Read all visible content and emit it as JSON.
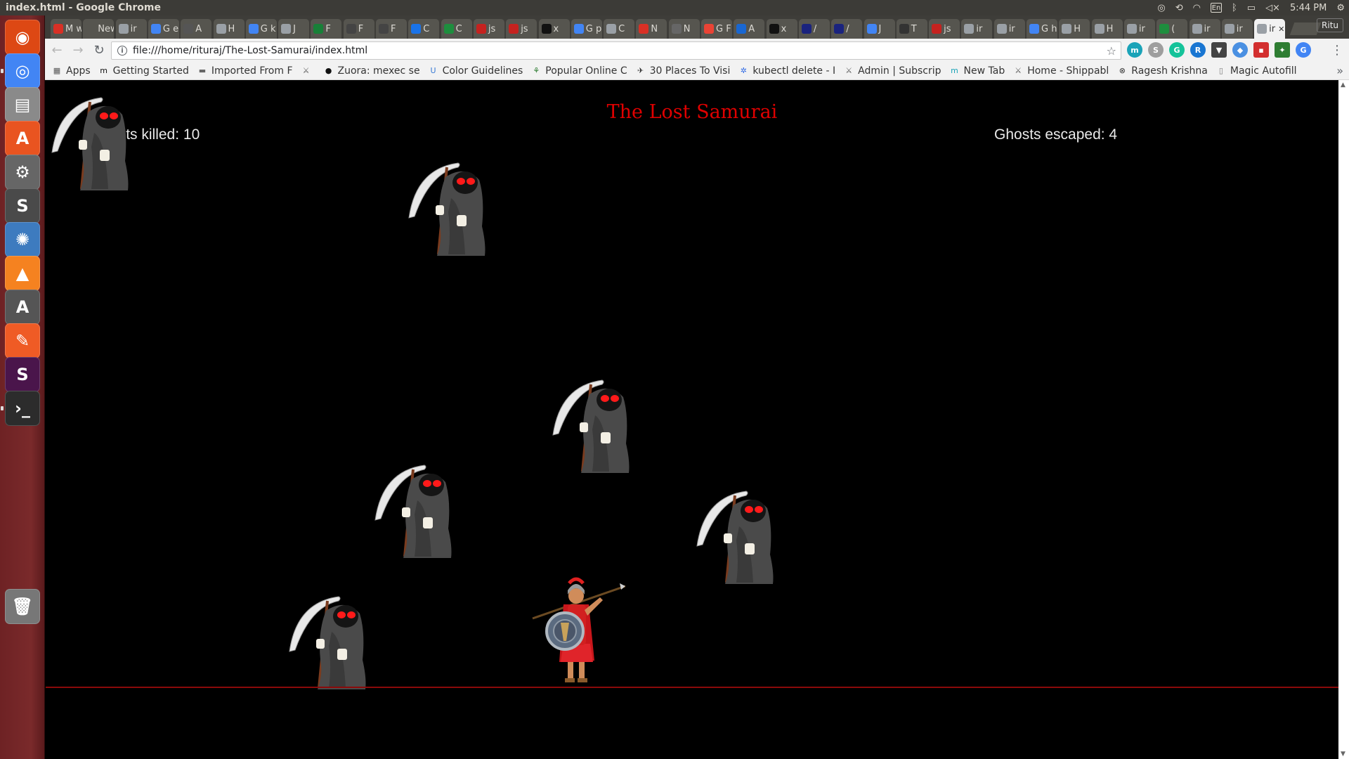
{
  "os": {
    "window_title": "index.html - Google Chrome",
    "keyboard_layout": "En",
    "time": "5:44 PM"
  },
  "launcher": {
    "items": [
      {
        "name": "ubuntu-dash",
        "glyph": "◉",
        "color": "#dd4814"
      },
      {
        "name": "chrome",
        "glyph": "◎",
        "color": "#4285f4"
      },
      {
        "name": "files",
        "glyph": "▤",
        "color": "#8a8a8a"
      },
      {
        "name": "software-center",
        "glyph": "A",
        "color": "#e95420"
      },
      {
        "name": "system-settings",
        "glyph": "⚙",
        "color": "#666"
      },
      {
        "name": "sublime-text",
        "glyph": "S",
        "color": "#4a4a4a"
      },
      {
        "name": "shotwell",
        "glyph": "✺",
        "color": "#3d7bbf"
      },
      {
        "name": "vlc",
        "glyph": "▲",
        "color": "#f58220"
      },
      {
        "name": "software-updater",
        "glyph": "A",
        "color": "#555"
      },
      {
        "name": "postman",
        "glyph": "✎",
        "color": "#ef5b25"
      },
      {
        "name": "slack",
        "glyph": "S",
        "color": "#4a154b"
      },
      {
        "name": "terminal",
        "glyph": "›_",
        "color": "#2c2c2c"
      },
      {
        "name": "trash",
        "glyph": "🗑",
        "color": "#777"
      }
    ]
  },
  "tabs": [
    {
      "label": "M w",
      "color": "#d93025"
    },
    {
      "label": "New",
      "color": "#56554f"
    },
    {
      "label": "ir",
      "color": "#9aa0a6"
    },
    {
      "label": "G e",
      "color": "#4285f4"
    },
    {
      "label": "A",
      "color": "#555"
    },
    {
      "label": "H",
      "color": "#9aa0a6"
    },
    {
      "label": "G k",
      "color": "#4285f4"
    },
    {
      "label": "J",
      "color": "#9aa0a6"
    },
    {
      "label": "F",
      "color": "#188038"
    },
    {
      "label": "F",
      "color": "#444"
    },
    {
      "label": "F",
      "color": "#444"
    },
    {
      "label": "C",
      "color": "#1a73e8"
    },
    {
      "label": "C",
      "color": "#1e8e3e"
    },
    {
      "label": "js",
      "color": "#c5221f"
    },
    {
      "label": "js",
      "color": "#c5221f"
    },
    {
      "label": "x",
      "color": "#111"
    },
    {
      "label": "G p",
      "color": "#4285f4"
    },
    {
      "label": "C",
      "color": "#9aa0a6"
    },
    {
      "label": "N",
      "color": "#d93025"
    },
    {
      "label": "N",
      "color": "#666"
    },
    {
      "label": "G F",
      "color": "#ea4335"
    },
    {
      "label": "A",
      "color": "#1967d2"
    },
    {
      "label": "x",
      "color": "#111"
    },
    {
      "label": "/",
      "color": "#1a237e"
    },
    {
      "label": "/",
      "color": "#1a237e"
    },
    {
      "label": "J",
      "color": "#4285f4"
    },
    {
      "label": "T",
      "color": "#333"
    },
    {
      "label": "js",
      "color": "#c5221f"
    },
    {
      "label": "ir",
      "color": "#9aa0a6"
    },
    {
      "label": "ir",
      "color": "#9aa0a6"
    },
    {
      "label": "G h",
      "color": "#4285f4"
    },
    {
      "label": "H",
      "color": "#9aa0a6"
    },
    {
      "label": "H",
      "color": "#9aa0a6"
    },
    {
      "label": "ir",
      "color": "#9aa0a6"
    },
    {
      "label": "(",
      "color": "#1e8e3e"
    },
    {
      "label": "ir",
      "color": "#9aa0a6"
    },
    {
      "label": "ir",
      "color": "#9aa0a6"
    },
    {
      "label": "ir",
      "color": "#9aa0a6",
      "active": true
    }
  ],
  "profile_name": "Ritu",
  "toolbar": {
    "url": "file:///home/rituraj/The-Lost-Samurai/index.html"
  },
  "bookmarks": [
    {
      "label": "Apps",
      "icon": "▦",
      "color": "#555"
    },
    {
      "label": "Getting Started",
      "icon": "m",
      "color": "#111"
    },
    {
      "label": "Imported From F",
      "icon": "▬",
      "color": "#666"
    },
    {
      "label": "",
      "icon": "⚔",
      "color": "#555"
    },
    {
      "label": "Zuora: mexec se",
      "icon": "●",
      "color": "#111"
    },
    {
      "label": "Color Guidelines",
      "icon": "U",
      "color": "#3a7bd5"
    },
    {
      "label": "Popular Online C",
      "icon": "⚘",
      "color": "#2e7d32"
    },
    {
      "label": "30 Places To Visi",
      "icon": "✈",
      "color": "#333"
    },
    {
      "label": "kubectl delete - I",
      "icon": "✲",
      "color": "#326ce5"
    },
    {
      "label": "Admin | Subscrip",
      "icon": "⚔",
      "color": "#555"
    },
    {
      "label": "New Tab",
      "icon": "m",
      "color": "#1aa3b8"
    },
    {
      "label": "Home - Shippabl",
      "icon": "⚔",
      "color": "#555"
    },
    {
      "label": "Ragesh Krishna",
      "icon": "⊗",
      "color": "#333"
    },
    {
      "label": "Magic Autofill",
      "icon": "▯",
      "color": "#777"
    }
  ],
  "game": {
    "title": "The Lost Samurai",
    "ghosts_killed_label": "Ghosts killed: 10",
    "ghosts_escaped_label": "Ghosts escaped: 4",
    "ghosts_killed": 10,
    "ghosts_escaped": 4,
    "ghosts_on_screen": 6,
    "colors": {
      "title": "#e00000",
      "hud_text": "#e9e9e9",
      "ground_line": "#8a0a0a",
      "ghost_eyes": "#ff1a1a"
    }
  }
}
